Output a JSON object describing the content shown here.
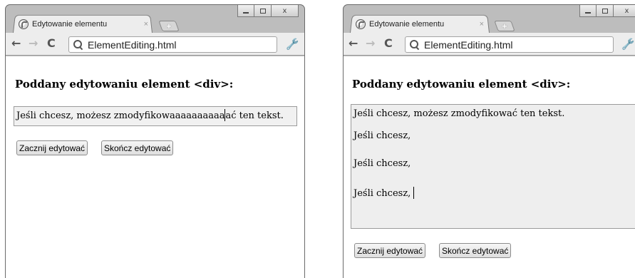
{
  "left_window": {
    "tab": {
      "title": "Edytowanie elementu",
      "close": "×"
    },
    "new_tab": "+",
    "address": "ElementEditing.html",
    "heading": "Poddany edytowaniu element <div>:",
    "editable_before_caret": "Jeśli chcesz, możesz zmodyfikowaaaaaaaaaa",
    "editable_after_caret": "ać ten tekst.",
    "buttons": {
      "start": "Zacznij edytować",
      "stop": "Skończ edytować"
    }
  },
  "right_window": {
    "tab": {
      "title": "Edytowanie elementu",
      "close": "×"
    },
    "new_tab": "+",
    "address": "ElementEditing.html",
    "heading": "Poddany edytowaniu element <div>:",
    "paragraphs": [
      "Jeśli chcesz, możesz zmodyfikować ten tekst.",
      "Jeśli chcesz,",
      "Jeśli chcesz,",
      "Jeśli chcesz, "
    ],
    "buttons": {
      "start": "Zacznij edytować",
      "stop": "Skończ edytować"
    }
  },
  "icons": {
    "back": "←",
    "forward": "→",
    "reload": "C",
    "wrench": "🔧",
    "minimize": "minimize-icon",
    "maximize": "maximize-icon",
    "close": "x"
  }
}
